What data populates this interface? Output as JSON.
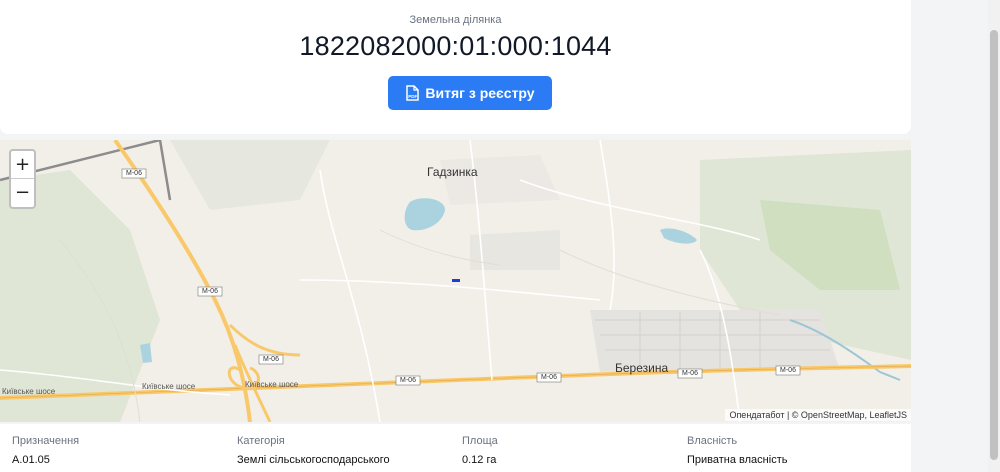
{
  "header": {
    "subtitle": "Земельна ділянка",
    "parcel_number": "1822082000:01:000:1044",
    "extract_button": "Витяг з реєстру"
  },
  "map": {
    "zoom_in": "+",
    "zoom_out": "−",
    "places": {
      "gadzynka": "Гадзинка",
      "berezyna": "Березина"
    },
    "road_labels": {
      "m06": "M-06",
      "kyiv_highway": "Київське шосе"
    },
    "attribution": "Опендатабот | © OpenStreetMap, LeafletJS",
    "colors": {
      "background": "#f2efe9",
      "road": "#f9c86a",
      "water": "#aad3df",
      "forest": "#c8dcb4",
      "parcel": "#1a3fd6"
    }
  },
  "info": {
    "purpose": {
      "label": "Призначення",
      "value": "A.01.05"
    },
    "category": {
      "label": "Категорія",
      "value": "Землі сільськогосподарського"
    },
    "area": {
      "label": "Площа",
      "value": "0.12 га"
    },
    "ownership": {
      "label": "Власність",
      "value": "Приватна власність"
    }
  },
  "colors": {
    "button": "#2b7bf5"
  }
}
